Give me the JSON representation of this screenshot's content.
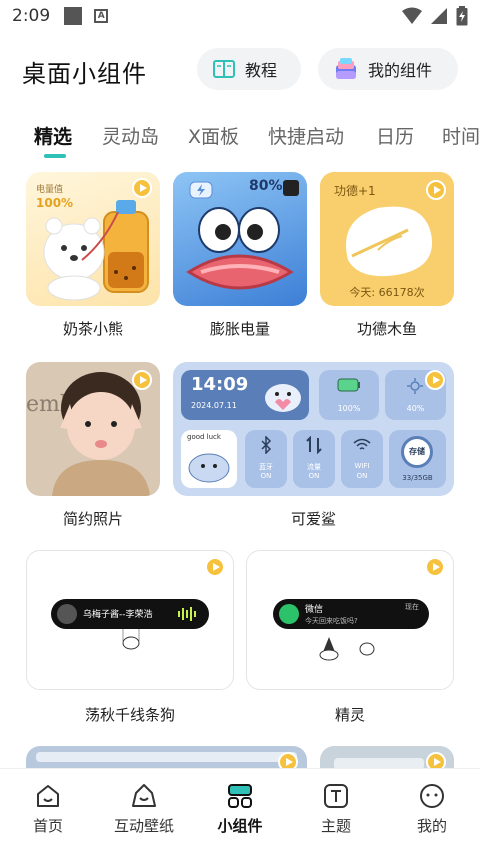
{
  "status_bar": {
    "time": "2:09"
  },
  "header": {
    "title": "桌面小组件",
    "tutorial_label": "教程",
    "my_widgets_label": "我的组件"
  },
  "tabs": [
    {
      "label": "精选"
    },
    {
      "label": "灵动岛"
    },
    {
      "label": "X面板"
    },
    {
      "label": "快捷启动"
    },
    {
      "label": "日历"
    },
    {
      "label": "时间"
    }
  ],
  "cards": {
    "milk_tea_bear": {
      "label": "奶茶小熊",
      "battery_title": "电量值",
      "battery_value": "100%"
    },
    "puffy_battery": {
      "label": "膨胀电量",
      "battery_value": "80%"
    },
    "merit_fish": {
      "label": "功德木鱼",
      "merit": "功德+1",
      "today": "今天: 66178次"
    },
    "simple_photo": {
      "label": "简约照片",
      "photo_text": "emb"
    },
    "cute_shark": {
      "label": "可爱鲨",
      "time": "14:09",
      "date": "2024.07.11",
      "battery": "100%",
      "brightness": "40%",
      "good_luck": "good luck",
      "bluetooth": "蓝牙",
      "bluetooth_state": "ON",
      "data": "流量",
      "data_state": "ON",
      "wifi": "WIFI",
      "wifi_state": "ON",
      "storage_label": "存储",
      "storage": "33/35GB"
    },
    "swing_dog": {
      "label": "荡秋千线条狗",
      "song": "乌梅子酱--李荣浩"
    },
    "elf": {
      "label": "精灵",
      "app": "微信",
      "time_tag": "现在",
      "message": "今天回来吃饭吗?"
    }
  },
  "bottom_nav": [
    {
      "label": "首页"
    },
    {
      "label": "互动壁纸"
    },
    {
      "label": "小组件"
    },
    {
      "label": "主题"
    },
    {
      "label": "我的"
    }
  ],
  "colors": {
    "accent": "#2fc1b8",
    "play": "#f6c23d"
  }
}
